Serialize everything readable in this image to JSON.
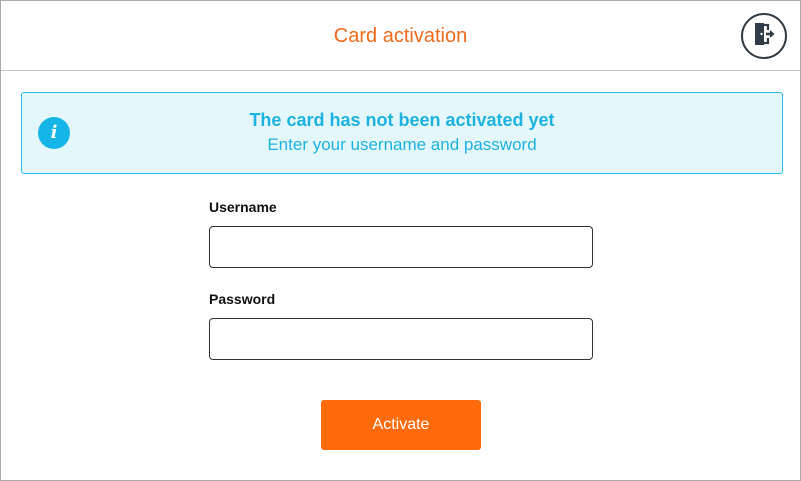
{
  "header": {
    "title": "Card activation",
    "exit_icon": "logout-door-icon"
  },
  "info": {
    "icon": "info-icon",
    "icon_glyph": "i",
    "title": "The card has not been activated yet",
    "subtitle": "Enter your username and password"
  },
  "form": {
    "username_label": "Username",
    "username_value": "",
    "password_label": "Password",
    "password_value": "",
    "activate_label": "Activate"
  },
  "colors": {
    "accent": "#ff6b0b",
    "title": "#f26a1b",
    "info": "#1eb2e3",
    "info_bg": "#e4f7fd"
  }
}
